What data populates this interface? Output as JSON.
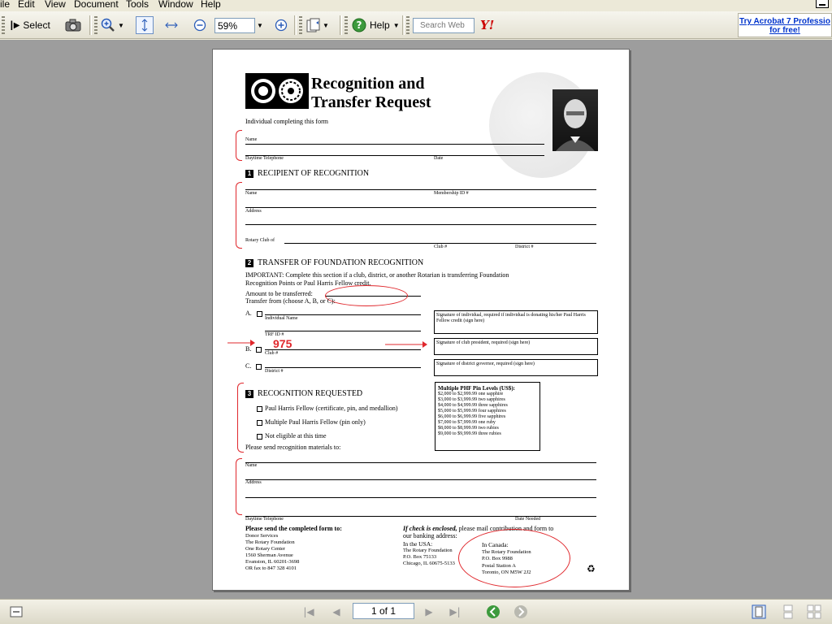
{
  "menu": {
    "items": [
      "ile",
      "Edit",
      "View",
      "Document",
      "Tools",
      "Window",
      "Help"
    ]
  },
  "toolbar": {
    "select_label": "Select",
    "zoom_value": "59%",
    "help_label": "Help",
    "search_placeholder": "Search Web",
    "yahoo_label": "Y!",
    "ad_line1": "Try Acrobat 7 Professio",
    "ad_line2": "for free!"
  },
  "status": {
    "page_indicator": "1 of 1"
  },
  "document": {
    "title_line1": "Recognition and",
    "title_line2": "Transfer Request",
    "individual_label": "Individual completing this form",
    "name_label": "Name",
    "daytime_phone_label": "Daytime Telephone",
    "date_label": "Date",
    "section1_num": "1",
    "section1_title": "RECIPIENT OF RECOGNITION",
    "membership_label": "Membership ID #",
    "address_label": "Address",
    "rotary_club_label": "Rotary Club of",
    "club_num_label": "Club #",
    "district_num_label": "District #",
    "section2_num": "2",
    "section2_title": "TRANSFER OF FOUNDATION RECOGNITION",
    "important_line1": "IMPORTANT: Complete this section if a club, district, or another Rotarian is transferring Foundation",
    "important_line2": "Recognition Points or Paul Harris Fellow credit.",
    "amount_label": "Amount to be transferred:",
    "transfer_from_label": "Transfer from (choose A, B, or C):",
    "opt_a": "A.",
    "opt_b": "B.",
    "opt_c": "C.",
    "individual_name_label": "Individual Name",
    "trf_id_label": "TRF ID #",
    "club_hash_label": "Club #",
    "district_hash_label": "District #",
    "annotation_value": "975",
    "sig_individual": "Signature of individual, required if individual is donating his/her Paul Harris Fellow credit (sign here)",
    "sig_club": "Signature of club president, required (sign here)",
    "sig_district": "Signature of district governor, required (sign here)",
    "section3_num": "3",
    "section3_title": "RECOGNITION REQUESTED",
    "rec_opt1": "Paul Harris Fellow (certificate, pin, and medallion)",
    "rec_opt2": "Multiple Paul Harris Fellow (pin only)",
    "rec_opt3": "Not eligible at this time",
    "send_materials_label": "Please send recognition materials to:",
    "phf_levels_title": "Multiple PHF Pin Levels (US$):",
    "phf_levels": [
      "$2,000 to $2,999.99 one sapphire",
      "$3,000 to $3,999.99 two sapphires",
      "$4,000 to $4,999.99 three sapphires",
      "$5,000 to $5,999.99 four sapphires",
      "$6,000 to $6,999.99 five sapphires",
      "$7,000 to $7,999.99 one ruby",
      "$8,000 to $8,999.99 two rubies",
      "$9,000 to $9,999.99 three rubies"
    ],
    "date_needed_label": "Date Needed",
    "send_form_heading": "Please send the completed form to:",
    "send_form_lines": [
      "Donor Services",
      "The Rotary Foundation",
      "One Rotary Center",
      "1560 Sherman Avenue",
      "Evanston, IL 60201-3698",
      "OR fax to 847 328 4101"
    ],
    "check_enclosed_italic": "If check is enclosed,",
    "check_enclosed_rest": " please mail contribution and form to",
    "banking_line": "our banking address:",
    "usa_heading": "In the USA:",
    "usa_lines": [
      "The Rotary Foundation",
      "P.O. Box 75133",
      "Chicago, IL 60675-5133"
    ],
    "canada_heading": "In Canada:",
    "canada_lines": [
      "The Rotary Foundation",
      "P.O. Box 9988",
      "Postal Station A",
      "Toronto, ON  M5W 2J2"
    ]
  },
  "colors": {
    "annotation_red": "#e0282d",
    "link_blue": "#0033cc"
  }
}
